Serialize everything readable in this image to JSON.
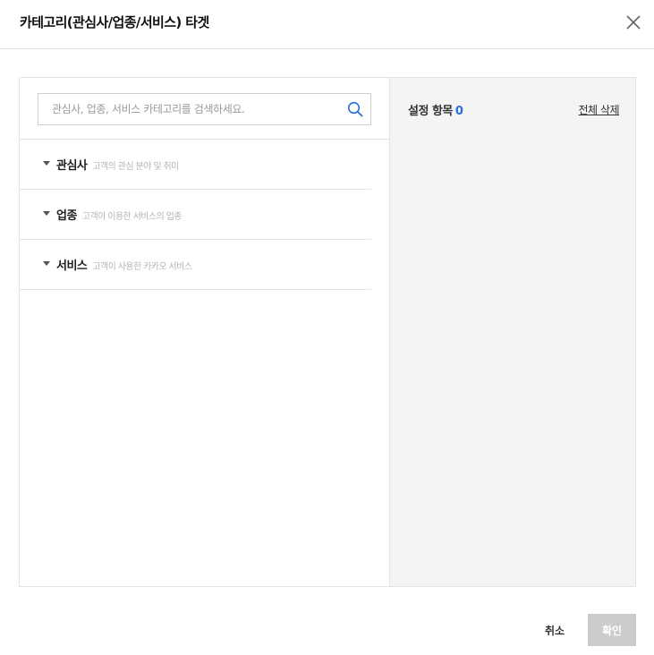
{
  "dialog": {
    "title": "카테고리(관심사/업종/서비스) 타겟"
  },
  "search": {
    "placeholder": "관심사, 업종, 서비스 카테고리를 검색하세요."
  },
  "categories": [
    {
      "name": "관심사",
      "description": "고객의 관심 분야 및 취미"
    },
    {
      "name": "업종",
      "description": "고객이 이용한 서비스의 업종"
    },
    {
      "name": "서비스",
      "description": "고객이 사용한 카카오 서비스"
    }
  ],
  "selection": {
    "label": "설정 항목",
    "count": "0",
    "delete_all_label": "전체 삭제"
  },
  "footer": {
    "cancel_label": "취소",
    "confirm_label": "확인"
  },
  "icons": {
    "close": "close-icon",
    "search": "search-icon",
    "expand": "caret-down-icon"
  },
  "colors": {
    "accent": "#2a6fdb",
    "disabled_button": "#cccccc",
    "panel_background": "#f4f4f4"
  }
}
